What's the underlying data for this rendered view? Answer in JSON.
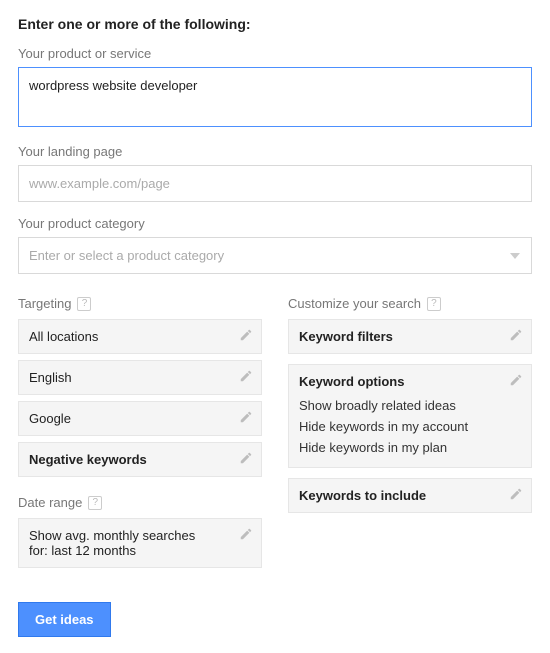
{
  "heading": "Enter one or more of the following:",
  "product_label": "Your product or service",
  "product_value": "wordpress website developer",
  "landing_label": "Your landing page",
  "landing_placeholder": "www.example.com/page",
  "category_label": "Your product category",
  "category_placeholder": "Enter or select a product category",
  "targeting": {
    "title": "Targeting",
    "locations": "All locations",
    "language": "English",
    "network": "Google",
    "negative": "Negative keywords"
  },
  "date_range": {
    "title": "Date range",
    "text": "Show avg. monthly searches for: last 12 months"
  },
  "customize": {
    "title": "Customize your search",
    "filters": "Keyword filters",
    "options_title": "Keyword options",
    "options": [
      "Show broadly related ideas",
      "Hide keywords in my account",
      "Hide keywords in my plan"
    ],
    "include": "Keywords to include"
  },
  "submit": "Get ideas"
}
